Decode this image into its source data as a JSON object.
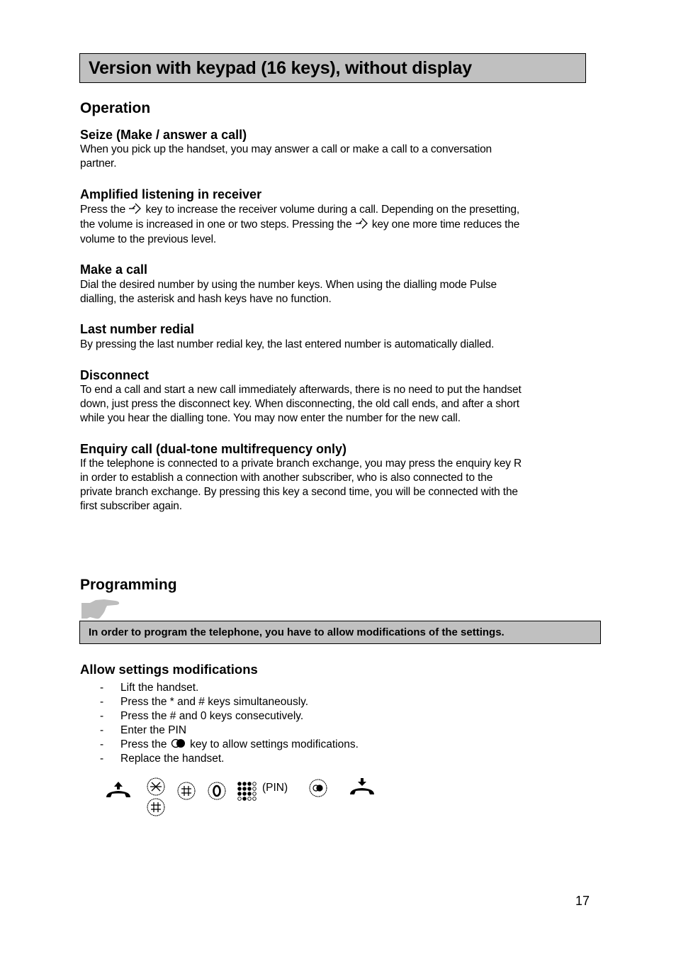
{
  "page": {
    "title": "Version with keypad (16 keys), without display",
    "page_number": "17"
  },
  "operation": {
    "heading": "Operation",
    "sections": [
      {
        "title": "Seize (Make / answer a call)",
        "lines": [
          "When you pick up the handset, you may answer a call or make a call to a conversation",
          "partner."
        ]
      },
      {
        "title": "Amplified listening in receiver",
        "line1_pre": "Press the",
        "line1_post": "key to increase the receiver volume during a call. Depending on the presetting,",
        "line2_pre": "the volume is increased in one or two steps. Pressing the",
        "line2_post": "key one more time reduces the",
        "line3": "volume to the previous level.",
        "icon": "volume-key-arrow-icon"
      },
      {
        "title": "Make a call",
        "lines": [
          "Dial the desired number by using the number keys. When using the dialling mode Pulse",
          "dialling, the asterisk and hash keys have no function."
        ]
      },
      {
        "title": "Last number redial",
        "lines": [
          "By pressing the last number redial key, the last entered number is automatically dialled."
        ]
      },
      {
        "title": "Disconnect",
        "lines": [
          "To end a call and start a new call immediately afterwards, there is no need to put the handset",
          "down, just press the disconnect key. When disconnecting, the old call ends, and after a short",
          "while you hear the dialling tone. You may now enter the number for the new call."
        ]
      },
      {
        "title": "Enquiry call (dual-tone multifrequency only)",
        "lines": [
          "If the telephone is connected to a private branch exchange, you may press the enquiry key R",
          "in order to establish a connection with another subscriber, who is also connected to the",
          "private branch exchange. By pressing this key a second time, you will be connected with the",
          "first subscriber again."
        ]
      }
    ]
  },
  "programming": {
    "heading": "Programming",
    "hint_icon": "pointing-hand-icon",
    "note": "In order to program the telephone, you have to allow modifications of the settings.",
    "subsection_title": "Allow settings modifications",
    "bullet": "-",
    "steps": [
      "Lift the handset.",
      "Press the * and # keys simultaneously.",
      "Press the # and 0 keys consecutively.",
      "Enter the PIN"
    ],
    "step5_pre": "Press the",
    "step5_post": "key to allow settings modifications.",
    "step6": "Replace the handset.",
    "sequence": {
      "icons": [
        "lift-handset-icon",
        "star-key-icon",
        "hash-key-icon",
        "hash-key-icon",
        "zero-key-icon",
        "keypad-icon",
        "confirm-key-icon",
        "replace-handset-icon"
      ],
      "pin_label": "(PIN)"
    }
  }
}
